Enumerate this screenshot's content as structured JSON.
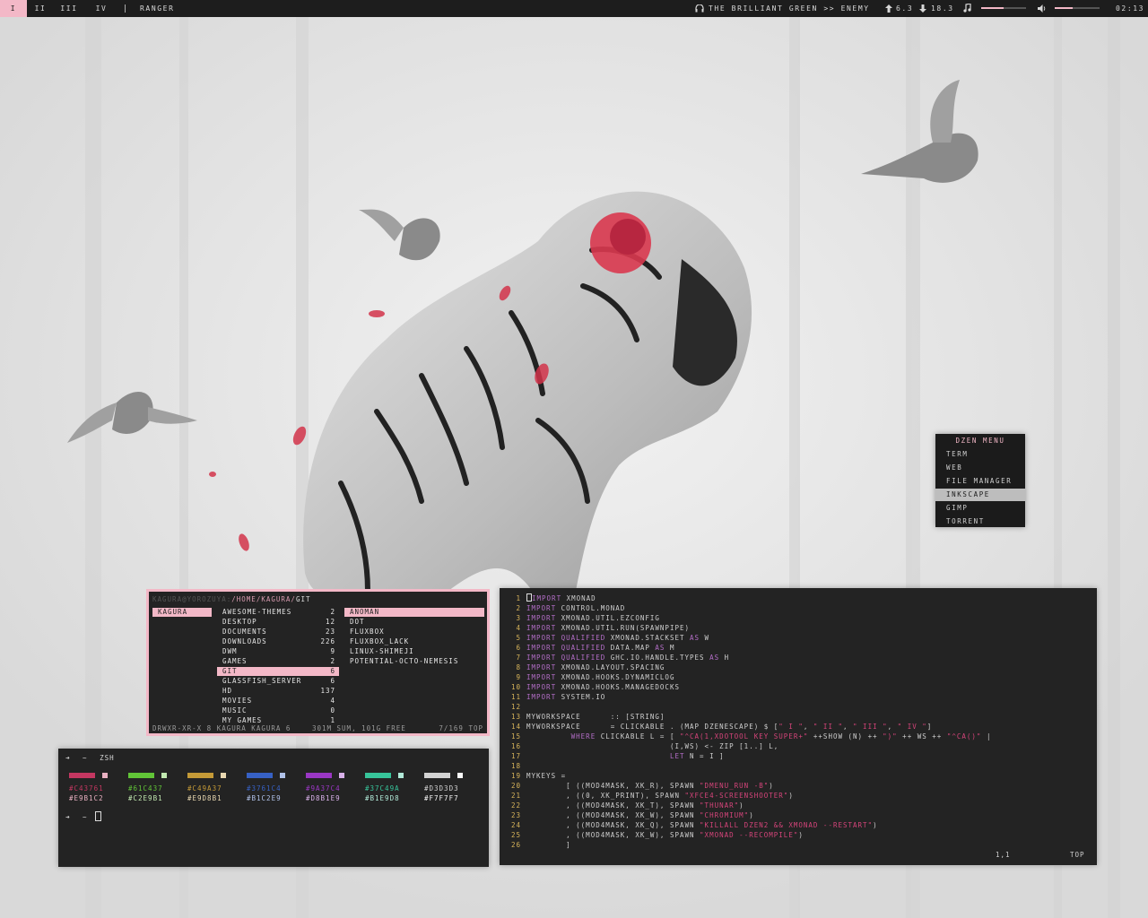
{
  "topbar": {
    "workspaces": [
      "I",
      "II",
      "III",
      "IV"
    ],
    "active_workspace": "I",
    "window_title": "RANGER",
    "now_playing": "THE BRILLIANT GREEN >> ENEMY",
    "net_up": "6.3",
    "net_down": "18.3",
    "clock": "02:13",
    "music_volume_level": 0.5,
    "system_volume_level": 0.4,
    "accent": "#f3b8c7"
  },
  "dzen_menu": {
    "title": "DZEN MENU",
    "items": [
      "TERM",
      "WEB",
      "FILE MANAGER",
      "INKSCAPE",
      "GIMP",
      "TORRENT"
    ],
    "selected": "INKSCAPE"
  },
  "ranger": {
    "path_user": "KAGURA@YOROZUYA:",
    "path_dir": "/HOME/KAGURA/",
    "path_leaf": "GIT",
    "parent_col": [
      "KAGURA"
    ],
    "dirs": [
      {
        "name": "AWESOME-THEMES",
        "count": "2"
      },
      {
        "name": "DESKTOP",
        "count": "12"
      },
      {
        "name": "DOCUMENTS",
        "count": "23"
      },
      {
        "name": "DOWNLOADS",
        "count": "226"
      },
      {
        "name": "DWM",
        "count": "9"
      },
      {
        "name": "GAMES",
        "count": "2"
      },
      {
        "name": "GIT",
        "count": "6"
      },
      {
        "name": "GLASSFISH_SERVER",
        "count": "6"
      },
      {
        "name": "HD",
        "count": "137"
      },
      {
        "name": "MOVIES",
        "count": "4"
      },
      {
        "name": "MUSIC",
        "count": "0"
      },
      {
        "name": "MY GAMES",
        "count": "1"
      }
    ],
    "selected_dir": "GIT",
    "preview": [
      "ANOMAN",
      "DOT",
      "FLUXBOX",
      "FLUXBOX_LACK",
      "LINUX-SHIMEJI",
      "POTENTIAL-OCTO-NEMESIS"
    ],
    "preview_selected": "ANOMAN",
    "status_left": "DRWXR-XR-X 8 KAGURA KAGURA 6",
    "status_mid": "301M SUM, 101G FREE",
    "status_right": "7/169  TOP"
  },
  "zsh": {
    "prompt_arrow": "➜",
    "prompt_dir": "~",
    "command": "ZSH",
    "palette": [
      {
        "normal": "#C43761",
        "bright": "#E9B1C2"
      },
      {
        "normal": "#61C437",
        "bright": "#C2E9B1"
      },
      {
        "normal": "#C49A37",
        "bright": "#E9D8B1"
      },
      {
        "normal": "#3761C4",
        "bright": "#B1C2E9"
      },
      {
        "normal": "#9A37C4",
        "bright": "#D8B1E9"
      },
      {
        "normal": "#37C49A",
        "bright": "#B1E9D8"
      },
      {
        "normal": "#D3D3D3",
        "bright": "#F7F7F7"
      }
    ]
  },
  "vim": {
    "lines": [
      {
        "n": "1",
        "parts": [
          [
            "c",
            ""
          ],
          [
            "k",
            "IMPORT"
          ],
          [
            "t",
            " XMONAD"
          ]
        ]
      },
      {
        "n": "2",
        "parts": [
          [
            "k",
            "IMPORT"
          ],
          [
            "t",
            " CONTROL.MONAD"
          ]
        ]
      },
      {
        "n": "3",
        "parts": [
          [
            "k",
            "IMPORT"
          ],
          [
            "t",
            " XMONAD.UTIL.EZCONFIG"
          ]
        ]
      },
      {
        "n": "4",
        "parts": [
          [
            "k",
            "IMPORT"
          ],
          [
            "t",
            " XMONAD.UTIL.RUN(SPAWNPIPE)"
          ]
        ]
      },
      {
        "n": "5",
        "parts": [
          [
            "k",
            "IMPORT QUALIFIED"
          ],
          [
            "t",
            " XMONAD.STACKSET "
          ],
          [
            "k",
            "AS"
          ],
          [
            "t",
            " W"
          ]
        ]
      },
      {
        "n": "6",
        "parts": [
          [
            "k",
            "IMPORT QUALIFIED"
          ],
          [
            "t",
            " DATA.MAP "
          ],
          [
            "k",
            "AS"
          ],
          [
            "t",
            " M"
          ]
        ]
      },
      {
        "n": "7",
        "parts": [
          [
            "k",
            "IMPORT QUALIFIED"
          ],
          [
            "t",
            " GHC.IO.HANDLE.TYPES "
          ],
          [
            "k",
            "AS"
          ],
          [
            "t",
            " H"
          ]
        ]
      },
      {
        "n": "8",
        "parts": [
          [
            "k",
            "IMPORT"
          ],
          [
            "t",
            " XMONAD.LAYOUT.SPACING"
          ]
        ]
      },
      {
        "n": "9",
        "parts": [
          [
            "k",
            "IMPORT"
          ],
          [
            "t",
            " XMONAD.HOOKS.DYNAMICLOG"
          ]
        ]
      },
      {
        "n": "10",
        "parts": [
          [
            "k",
            "IMPORT"
          ],
          [
            "t",
            " XMONAD.HOOKS.MANAGEDOCKS"
          ]
        ]
      },
      {
        "n": "11",
        "parts": [
          [
            "k",
            "IMPORT"
          ],
          [
            "t",
            " SYSTEM.IO"
          ]
        ]
      },
      {
        "n": "12",
        "parts": []
      },
      {
        "n": "13",
        "parts": [
          [
            "t",
            "MYWORKSPACE      :: [STRING]"
          ]
        ]
      },
      {
        "n": "14",
        "parts": [
          [
            "t",
            "MYWORKSPACE      = CLICKABLE . (MAP DZENESCAPE) $ ["
          ],
          [
            "s",
            "\" I \""
          ],
          [
            "t",
            ", "
          ],
          [
            "s",
            "\" II \""
          ],
          [
            "t",
            ", "
          ],
          [
            "s",
            "\" III \""
          ],
          [
            "t",
            ", "
          ],
          [
            "s",
            "\" IV \""
          ],
          [
            "t",
            "]"
          ]
        ]
      },
      {
        "n": "15",
        "parts": [
          [
            "t",
            "         "
          ],
          [
            "k",
            "WHERE"
          ],
          [
            "t",
            " CLICKABLE L = [ "
          ],
          [
            "s",
            "\"^CA(1,XDOTOOL KEY SUPER+\""
          ],
          [
            "t",
            " ++SHOW (N) ++ "
          ],
          [
            "s",
            "\")\""
          ],
          [
            "t",
            " ++ WS ++ "
          ],
          [
            "s",
            "\"^CA()\""
          ],
          [
            "t",
            " |"
          ]
        ]
      },
      {
        "n": "16",
        "parts": [
          [
            "t",
            "                             (I,WS) <- ZIP [1..] L,"
          ]
        ]
      },
      {
        "n": "17",
        "parts": [
          [
            "t",
            "                             "
          ],
          [
            "k",
            "LET"
          ],
          [
            "t",
            " N = I ]"
          ]
        ]
      },
      {
        "n": "18",
        "parts": []
      },
      {
        "n": "19",
        "parts": [
          [
            "t",
            "MYKEYS ="
          ]
        ]
      },
      {
        "n": "20",
        "parts": [
          [
            "t",
            "        [ ((MOD4MASK, XK_R), SPAWN "
          ],
          [
            "s",
            "\"DMENU_RUN -B\""
          ],
          [
            "t",
            ")"
          ]
        ]
      },
      {
        "n": "21",
        "parts": [
          [
            "t",
            "        , ((0, XK_PRINT), SPAWN "
          ],
          [
            "s",
            "\"XFCE4-SCREENSHOOTER\""
          ],
          [
            "t",
            ")"
          ]
        ]
      },
      {
        "n": "22",
        "parts": [
          [
            "t",
            "        , ((MOD4MASK, XK_T), SPAWN "
          ],
          [
            "s",
            "\"THUNAR\""
          ],
          [
            "t",
            ")"
          ]
        ]
      },
      {
        "n": "23",
        "parts": [
          [
            "t",
            "        , ((MOD4MASK, XK_W), SPAWN "
          ],
          [
            "s",
            "\"CHROMIUM\""
          ],
          [
            "t",
            ")"
          ]
        ]
      },
      {
        "n": "24",
        "parts": [
          [
            "t",
            "        , ((MOD4MASK, XK_Q), SPAWN "
          ],
          [
            "s",
            "\"KILLALL DZEN2 && XMONAD --RESTART\""
          ],
          [
            "t",
            ")"
          ]
        ]
      },
      {
        "n": "25",
        "parts": [
          [
            "t",
            "        , ((MOD4MASK, XK_W), SPAWN "
          ],
          [
            "s",
            "\"XMONAD --RECOMPILE\""
          ],
          [
            "t",
            ")"
          ]
        ]
      },
      {
        "n": "26",
        "parts": [
          [
            "t",
            "        ]"
          ]
        ]
      }
    ],
    "cursor_pos": "1,1",
    "scroll_pos": "TOP"
  }
}
